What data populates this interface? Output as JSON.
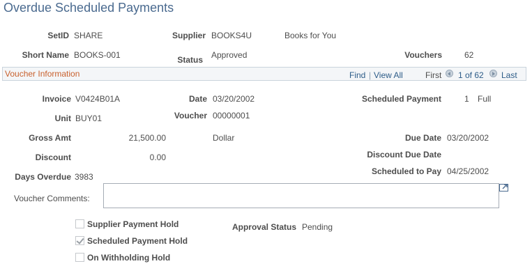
{
  "page": {
    "title": "Overdue Scheduled Payments"
  },
  "header": {
    "setid_label": "SetID",
    "setid_value": "SHARE",
    "supplier_label": "Supplier",
    "supplier_value": "BOOKS4U",
    "supplier_name": "Books for You",
    "short_name_label": "Short Name",
    "short_name_value": "BOOKS-001",
    "status_label": "Status",
    "status_value": "Approved",
    "vouchers_label": "Vouchers",
    "vouchers_value": "62"
  },
  "section": {
    "title": "Voucher Information",
    "find_label": "Find",
    "view_all_label": "View All",
    "separator": "|",
    "first_label": "First",
    "pager_text": "1 of 62",
    "last_label": "Last"
  },
  "voucher": {
    "invoice_label": "Invoice",
    "invoice_value": "V0424B01A",
    "date_label": "Date",
    "date_value": "03/20/2002",
    "scheduled_payment_label": "Scheduled Payment",
    "scheduled_payment_value": "1",
    "scheduled_payment_type": "Full",
    "unit_label": "Unit",
    "unit_value": "BUY01",
    "voucher_label": "Voucher",
    "voucher_value": "00000001",
    "gross_amt_label": "Gross Amt",
    "gross_amt_value": "21,500.00",
    "currency": "Dollar",
    "due_date_label": "Due Date",
    "due_date_value": "03/20/2002",
    "discount_label": "Discount",
    "discount_value": "0.00",
    "discount_due_date_label": "Discount Due Date",
    "days_overdue_label": "Days Overdue",
    "days_overdue_value": "3983",
    "scheduled_to_pay_label": "Scheduled to Pay",
    "scheduled_to_pay_value": "04/25/2002",
    "comments_label": "Voucher Comments:",
    "comments_value": ""
  },
  "holds": {
    "supplier_payment_hold_label": "Supplier Payment Hold",
    "supplier_payment_hold_checked": false,
    "scheduled_payment_hold_label": "Scheduled Payment Hold",
    "scheduled_payment_hold_checked": true,
    "withholding_hold_label": "On Withholding Hold",
    "withholding_hold_checked": false,
    "approval_status_label": "Approval Status",
    "approval_status_value": "Pending"
  },
  "icons": {
    "expand": "expand-icon",
    "prev": "arrow-left-icon",
    "next": "arrow-right-icon",
    "check": "checkmark-icon"
  },
  "colors": {
    "title": "#4a6a8f",
    "section_title": "#c8602d",
    "link": "#2d5c88"
  }
}
